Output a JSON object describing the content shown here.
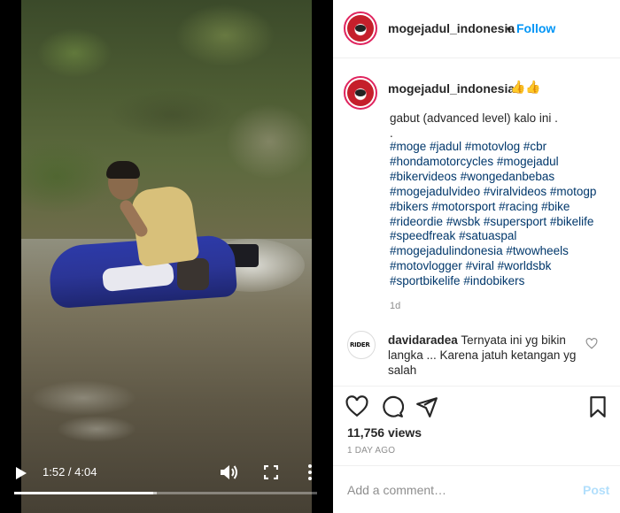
{
  "video": {
    "time_display": "1:52 / 4:04",
    "progress_fraction": 0.459,
    "buffered_fraction": 0.47
  },
  "header": {
    "username": "mogejadul_indonesia",
    "separator": "•",
    "follow_label": "Follow"
  },
  "caption": {
    "username": "mogejadul_indonesia",
    "emoji": "👍👍",
    "text": "gabut (advanced level) kalo ini .\n.",
    "hashtags": [
      "#moge",
      "#jadul",
      "#motovlog",
      "#cbr",
      "#hondamotorcycles",
      "#mogejadul",
      "#bikervideos",
      "#wongedanbebas",
      "#mogejadulvideo",
      "#viralvideos",
      "#motogp",
      "#bikers",
      "#motorsport",
      "#racing",
      "#bike",
      "#rideordie",
      "#wsbk",
      "#supersport",
      "#bikelife",
      "#speedfreak",
      "#satuaspal",
      "#mogejadulindonesia",
      "#twowheels",
      "#motovlogger",
      "#viral",
      "#worldsbk",
      "#sportbikelife",
      "#indobikers"
    ],
    "time_ago": "1d"
  },
  "comment": {
    "avatar_text": "RIDER",
    "username": "davidaradea",
    "text": "Ternyata ini yg bikin langka ... Karena jatuh ketangan yg salah"
  },
  "stats": {
    "views": "11,756 views",
    "date": "1 DAY AGO"
  },
  "add_comment": {
    "placeholder": "Add a comment…",
    "post_label": "Post"
  },
  "colors": {
    "link": "#0095f6",
    "hashtag": "#00376b",
    "muted": "#8e8e8e",
    "post_disabled": "#b2dffc"
  }
}
